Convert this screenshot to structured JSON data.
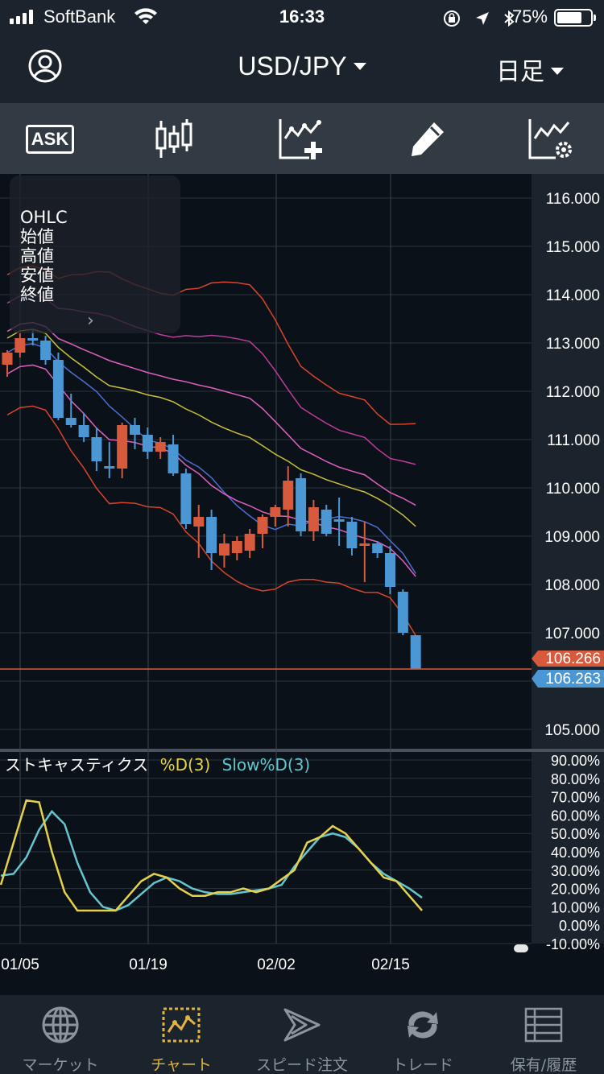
{
  "status_bar": {
    "carrier": "SoftBank",
    "time": "16:33",
    "battery": "75%"
  },
  "header": {
    "currency_pair": "USD/JPY",
    "period": "日足"
  },
  "toolbar": {
    "ask_label": "ASK",
    "tools": [
      "ask-icon",
      "candlestick-icon",
      "add-indicator-icon",
      "pencil-icon",
      "indicator-settings-icon"
    ]
  },
  "ohlc_panel": {
    "title": "OHLC",
    "open_label": "始値",
    "high_label": "高値",
    "low_label": "安値",
    "close_label": "終値"
  },
  "price_axis": {
    "ticks": [
      "116.000",
      "115.000",
      "114.000",
      "113.000",
      "112.000",
      "111.000",
      "110.000",
      "109.000",
      "108.000",
      "107.000",
      "105.000"
    ],
    "ask_price": "106.266",
    "bid_price": "106.263",
    "ask_color": "#d85a3c",
    "bid_color": "#4a97d4"
  },
  "indicator": {
    "name": "ストキャスティクス",
    "d_label": "%D(3)",
    "slow_label": "Slow%D(3)",
    "d_color": "#e6d24a",
    "slow_color": "#63c6cf",
    "ticks": [
      "90.00%",
      "80.00%",
      "70.00%",
      "60.00%",
      "50.00%",
      "40.00%",
      "30.00%",
      "20.00%",
      "10.00%",
      "0.00%",
      "-10.00%"
    ]
  },
  "date_axis": {
    "labels": [
      "01/05",
      "01/19",
      "02/02",
      "02/15"
    ]
  },
  "tab_bar": {
    "items": [
      {
        "label": "マーケット",
        "icon": "globe-icon"
      },
      {
        "label": "チャート",
        "icon": "chart-icon",
        "active": true
      },
      {
        "label": "スピード注文",
        "icon": "speed-order-icon"
      },
      {
        "label": "トレード",
        "icon": "trade-icon"
      },
      {
        "label": "保有/履歴",
        "icon": "positions-icon"
      }
    ],
    "active_color": "#e2b340"
  },
  "chart_data": {
    "type": "candlestick",
    "x_labels": [
      "01/05",
      "01/19",
      "02/02",
      "02/15"
    ],
    "y_range": [
      105.0,
      116.0
    ],
    "candles": [
      {
        "o": 112.55,
        "h": 112.85,
        "l": 112.3,
        "c": 112.8
      },
      {
        "o": 112.8,
        "h": 113.2,
        "l": 112.7,
        "c": 113.1
      },
      {
        "o": 113.1,
        "h": 113.3,
        "l": 112.95,
        "c": 113.05
      },
      {
        "o": 113.05,
        "h": 113.15,
        "l": 112.55,
        "c": 112.65
      },
      {
        "o": 112.65,
        "h": 112.8,
        "l": 111.4,
        "c": 111.45
      },
      {
        "o": 111.45,
        "h": 111.95,
        "l": 111.25,
        "c": 111.3
      },
      {
        "o": 111.3,
        "h": 111.55,
        "l": 110.95,
        "c": 111.05
      },
      {
        "o": 111.05,
        "h": 111.25,
        "l": 110.35,
        "c": 110.55
      },
      {
        "o": 110.45,
        "h": 110.95,
        "l": 110.2,
        "c": 110.4
      },
      {
        "o": 110.4,
        "h": 111.35,
        "l": 110.2,
        "c": 111.3
      },
      {
        "o": 111.3,
        "h": 111.45,
        "l": 110.8,
        "c": 111.1
      },
      {
        "o": 111.1,
        "h": 111.25,
        "l": 110.6,
        "c": 110.75
      },
      {
        "o": 110.75,
        "h": 111.05,
        "l": 110.6,
        "c": 110.95
      },
      {
        "o": 110.9,
        "h": 111.1,
        "l": 110.25,
        "c": 110.3
      },
      {
        "o": 110.3,
        "h": 110.4,
        "l": 109.15,
        "c": 109.25
      },
      {
        "o": 109.2,
        "h": 109.65,
        "l": 108.55,
        "c": 109.4
      },
      {
        "o": 109.4,
        "h": 109.55,
        "l": 108.3,
        "c": 108.65
      },
      {
        "o": 108.6,
        "h": 109.05,
        "l": 108.35,
        "c": 108.85
      },
      {
        "o": 108.65,
        "h": 109.0,
        "l": 108.5,
        "c": 108.9
      },
      {
        "o": 108.7,
        "h": 109.15,
        "l": 108.55,
        "c": 109.05
      },
      {
        "o": 109.05,
        "h": 109.45,
        "l": 108.75,
        "c": 109.4
      },
      {
        "o": 109.4,
        "h": 109.65,
        "l": 109.2,
        "c": 109.6
      },
      {
        "o": 109.55,
        "h": 110.45,
        "l": 109.2,
        "c": 110.15
      },
      {
        "o": 110.2,
        "h": 110.3,
        "l": 109.0,
        "c": 109.1
      },
      {
        "o": 109.1,
        "h": 109.75,
        "l": 108.9,
        "c": 109.6
      },
      {
        "o": 109.55,
        "h": 109.65,
        "l": 109.0,
        "c": 109.05
      },
      {
        "o": 109.35,
        "h": 109.8,
        "l": 108.8,
        "c": 109.3
      },
      {
        "o": 109.3,
        "h": 109.4,
        "l": 108.6,
        "c": 108.75
      },
      {
        "o": 108.8,
        "h": 109.3,
        "l": 108.05,
        "c": 108.85
      },
      {
        "o": 108.85,
        "h": 108.9,
        "l": 108.55,
        "c": 108.65
      },
      {
        "o": 108.65,
        "h": 108.8,
        "l": 107.8,
        "c": 107.95
      },
      {
        "o": 107.85,
        "h": 107.9,
        "l": 106.95,
        "c": 107.0
      },
      {
        "o": 106.95,
        "h": 106.95,
        "l": 106.26,
        "c": 106.26
      }
    ],
    "stochastic": {
      "y_range": [
        -10,
        90
      ],
      "d": [
        22,
        45,
        68,
        67,
        40,
        18,
        8,
        8,
        8,
        8,
        16,
        24,
        28,
        26,
        20,
        16,
        16,
        18,
        18,
        20,
        18,
        20,
        25,
        30,
        45,
        48,
        54,
        50,
        42,
        34,
        26,
        24,
        16,
        8
      ],
      "slow_d": [
        27,
        28,
        37,
        52,
        62,
        55,
        34,
        18,
        10,
        8,
        11,
        17,
        23,
        26,
        24,
        20,
        18,
        17,
        17,
        18,
        19,
        20,
        22,
        32,
        40,
        48,
        50,
        48,
        42,
        34,
        28,
        24,
        20,
        15
      ]
    }
  }
}
